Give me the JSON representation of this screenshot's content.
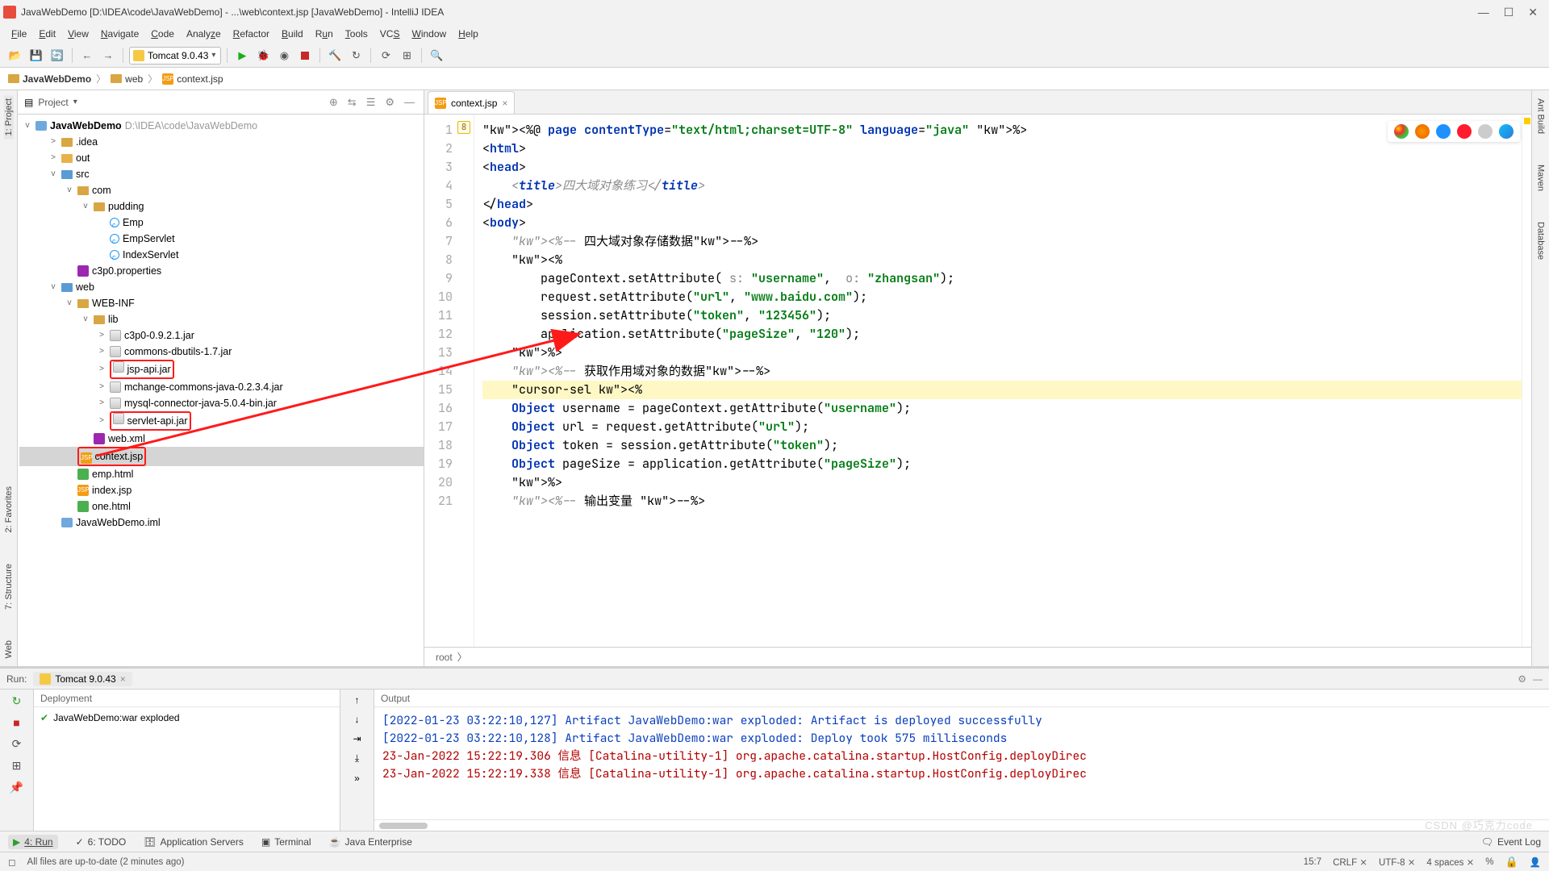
{
  "window": {
    "title": "JavaWebDemo [D:\\IDEA\\code\\JavaWebDemo] - ...\\web\\context.jsp [JavaWebDemo] - IntelliJ IDEA"
  },
  "menu": [
    "File",
    "Edit",
    "View",
    "Navigate",
    "Code",
    "Analyze",
    "Refactor",
    "Build",
    "Run",
    "Tools",
    "VCS",
    "Window",
    "Help"
  ],
  "toolbar": {
    "run_config": "Tomcat 9.0.43"
  },
  "breadcrumb": {
    "project": "JavaWebDemo",
    "folder": "web",
    "file": "context.jsp"
  },
  "side_tabs_left": [
    "1: Project",
    "2: Favorites",
    "7: Structure",
    "Web"
  ],
  "side_tabs_right": [
    "Ant Build",
    "Maven",
    "Database"
  ],
  "project_panel": {
    "title": "Project",
    "root": {
      "name": "JavaWebDemo",
      "path": "D:\\IDEA\\code\\JavaWebDemo"
    },
    "tree": [
      {
        "indent": 1,
        "exp": ">",
        "icon": "folder",
        "label": ".idea"
      },
      {
        "indent": 1,
        "exp": ">",
        "icon": "folder-hl",
        "label": "out"
      },
      {
        "indent": 1,
        "exp": "v",
        "icon": "folder-src",
        "label": "src"
      },
      {
        "indent": 2,
        "exp": "v",
        "icon": "folder",
        "label": "com"
      },
      {
        "indent": 3,
        "exp": "v",
        "icon": "folder",
        "label": "pudding"
      },
      {
        "indent": 4,
        "exp": "",
        "icon": "class",
        "label": "Emp"
      },
      {
        "indent": 4,
        "exp": "",
        "icon": "class",
        "label": "EmpServlet"
      },
      {
        "indent": 4,
        "exp": "",
        "icon": "class",
        "label": "IndexServlet"
      },
      {
        "indent": 2,
        "exp": "",
        "icon": "props",
        "label": "c3p0.properties"
      },
      {
        "indent": 1,
        "exp": "v",
        "icon": "folder-web",
        "label": "web"
      },
      {
        "indent": 2,
        "exp": "v",
        "icon": "folder",
        "label": "WEB-INF"
      },
      {
        "indent": 3,
        "exp": "v",
        "icon": "folder",
        "label": "lib"
      },
      {
        "indent": 4,
        "exp": ">",
        "icon": "jar",
        "label": "c3p0-0.9.2.1.jar"
      },
      {
        "indent": 4,
        "exp": ">",
        "icon": "jar",
        "label": "commons-dbutils-1.7.jar"
      },
      {
        "indent": 4,
        "exp": ">",
        "icon": "jar",
        "label": "jsp-api.jar",
        "boxed": true
      },
      {
        "indent": 4,
        "exp": ">",
        "icon": "jar",
        "label": "mchange-commons-java-0.2.3.4.jar"
      },
      {
        "indent": 4,
        "exp": ">",
        "icon": "jar",
        "label": "mysql-connector-java-5.0.4-bin.jar"
      },
      {
        "indent": 4,
        "exp": ">",
        "icon": "jar",
        "label": "servlet-api.jar",
        "boxed": true
      },
      {
        "indent": 3,
        "exp": "",
        "icon": "xml",
        "label": "web.xml"
      },
      {
        "indent": 2,
        "exp": "",
        "icon": "jsp",
        "label": "context.jsp",
        "boxed": true,
        "selected": true
      },
      {
        "indent": 2,
        "exp": "",
        "icon": "html",
        "label": "emp.html"
      },
      {
        "indent": 2,
        "exp": "",
        "icon": "jsp",
        "label": "index.jsp"
      },
      {
        "indent": 2,
        "exp": "",
        "icon": "html",
        "label": "one.html"
      },
      {
        "indent": 1,
        "exp": "",
        "icon": "iml",
        "label": "JavaWebDemo.iml"
      }
    ]
  },
  "editor": {
    "tab": "context.jsp",
    "gutter_start": 1,
    "gutter_end": 21,
    "inspection_mark": "8",
    "breadcrumb": "root",
    "code_plain": "<%@ page contentType=\"text/html;charset=UTF-8\" language=\"java\" %>\n<html>\n<head>\n    <title>四大域对象练习</title>\n</head>\n<body>\n    <%-- 四大域对象存储数据--%>\n    <%\n        pageContext.setAttribute( s: \"username\",  o: \"zhangsan\");\n        request.setAttribute(\"url\", \"www.baidu.com\");\n        session.setAttribute(\"token\", \"123456\");\n        application.setAttribute(\"pageSize\", \"120\");\n    %>\n    <%-- 获取作用域对象的数据--%>\n    <%\n    Object username = pageContext.getAttribute(\"username\");\n    Object url = request.getAttribute(\"url\");\n    Object token = session.getAttribute(\"token\");\n    Object pageSize = application.getAttribute(\"pageSize\");\n    %>\n    <%-- 输出变量 --%>"
  },
  "run": {
    "label": "Run:",
    "config": "Tomcat 9.0.43",
    "deployment_header": "Deployment",
    "output_header": "Output",
    "deployment_item": "JavaWebDemo:war exploded",
    "output_lines": [
      {
        "cls": "blue",
        "text": "[2022-01-23 03:22:10,127] Artifact JavaWebDemo:war exploded: Artifact is deployed successfully"
      },
      {
        "cls": "blue",
        "text": "[2022-01-23 03:22:10,128] Artifact JavaWebDemo:war exploded: Deploy took 575 milliseconds"
      },
      {
        "cls": "red",
        "text": "23-Jan-2022 15:22:19.306 信息 [Catalina-utility-1] org.apache.catalina.startup.HostConfig.deployDirec"
      },
      {
        "cls": "red",
        "text": "23-Jan-2022 15:22:19.338 信息 [Catalina-utility-1] org.apache.catalina.startup.HostConfig.deployDirec"
      }
    ]
  },
  "bottom_tools": {
    "items": [
      "4: Run",
      "6: TODO",
      "Application Servers",
      "Terminal",
      "Java Enterprise"
    ],
    "event_log": "Event Log"
  },
  "status": {
    "msg": "All files are up-to-date (2 minutes ago)",
    "pos": "15:7",
    "eol": "CRLF",
    "enc": "UTF-8",
    "indent": "4 spaces",
    "ctx": "%"
  },
  "watermark": "CSDN @巧克力code"
}
